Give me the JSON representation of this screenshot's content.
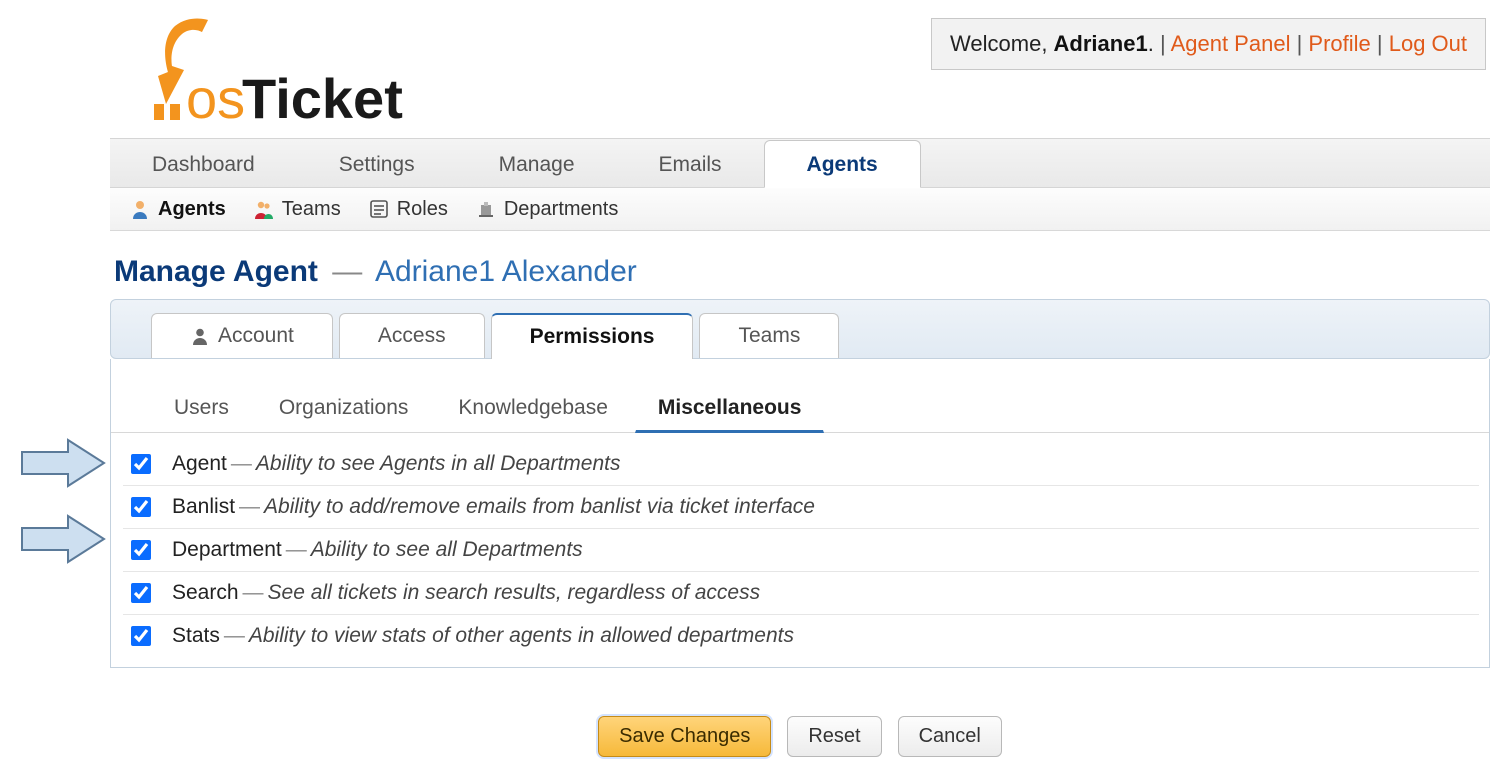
{
  "header": {
    "welcome_prefix": "Welcome, ",
    "username": "Adriane1",
    "links": {
      "agent_panel": "Agent Panel",
      "profile": "Profile",
      "logout": "Log Out"
    }
  },
  "main_nav": {
    "dashboard": "Dashboard",
    "settings": "Settings",
    "manage": "Manage",
    "emails": "Emails",
    "agents": "Agents",
    "active": "agents"
  },
  "sub_nav": {
    "agents": "Agents",
    "teams": "Teams",
    "roles": "Roles",
    "departments": "Departments",
    "active": "agents"
  },
  "page": {
    "title": "Manage Agent",
    "dash": "—",
    "agent_name": "Adriane1 Alexander"
  },
  "card_tabs": {
    "account": "Account",
    "access": "Access",
    "permissions": "Permissions",
    "teams": "Teams",
    "active": "permissions"
  },
  "inner_tabs": {
    "users": "Users",
    "organizations": "Organizations",
    "knowledgebase": "Knowledgebase",
    "miscellaneous": "Miscellaneous",
    "active": "miscellaneous"
  },
  "permissions": [
    {
      "key": "agent",
      "label": "Agent",
      "desc": "Ability to see Agents in all Departments",
      "checked": true
    },
    {
      "key": "banlist",
      "label": "Banlist",
      "desc": "Ability to add/remove emails from banlist via ticket interface",
      "checked": true
    },
    {
      "key": "department",
      "label": "Department",
      "desc": "Ability to see all Departments",
      "checked": true
    },
    {
      "key": "search",
      "label": "Search",
      "desc": "See all tickets in search results, regardless of access",
      "checked": true
    },
    {
      "key": "stats",
      "label": "Stats",
      "desc": "Ability to view stats of other agents in allowed departments",
      "checked": true
    }
  ],
  "buttons": {
    "save": "Save Changes",
    "reset": "Reset",
    "cancel": "Cancel"
  },
  "dash": "—",
  "arrows": {
    "rows_highlighted": [
      "agent",
      "department"
    ]
  }
}
